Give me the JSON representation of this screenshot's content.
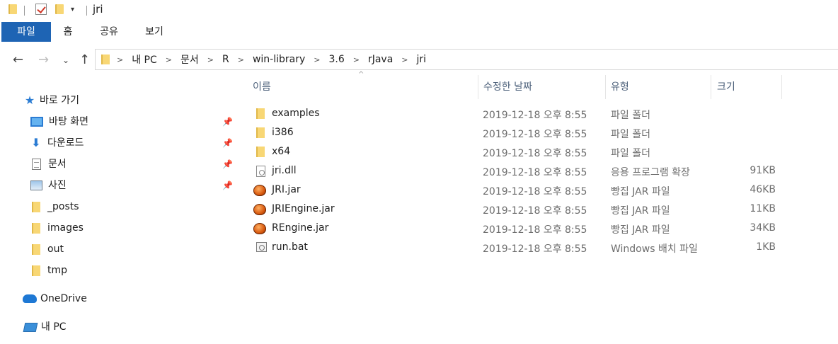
{
  "window": {
    "title": "jri"
  },
  "ribbon": {
    "tabs": [
      "파일",
      "홈",
      "공유",
      "보기"
    ]
  },
  "address": {
    "crumbs": [
      "내 PC",
      "문서",
      "R",
      "win-library",
      "3.6",
      "rJava",
      "jri"
    ]
  },
  "nav": {
    "quick_access": "바로 가기",
    "items": [
      {
        "label": "바탕 화면",
        "icon": "desktop-icon",
        "pinned": true
      },
      {
        "label": "다운로드",
        "icon": "download-icon",
        "pinned": true
      },
      {
        "label": "문서",
        "icon": "document-icon",
        "pinned": true
      },
      {
        "label": "사진",
        "icon": "pictures-icon",
        "pinned": true
      },
      {
        "label": "_posts",
        "icon": "folder-icon",
        "pinned": false
      },
      {
        "label": "images",
        "icon": "folder-icon",
        "pinned": false
      },
      {
        "label": "out",
        "icon": "folder-icon",
        "pinned": false
      },
      {
        "label": "tmp",
        "icon": "folder-icon",
        "pinned": false
      }
    ],
    "onedrive": "OneDrive",
    "this_pc": "내 PC"
  },
  "columns": {
    "name": "이름",
    "date": "수정한 날짜",
    "type": "유형",
    "size": "크기"
  },
  "files": [
    {
      "name": "examples",
      "date": "2019-12-18 오후 8:55",
      "type": "파일 폴더",
      "size": "",
      "icon": "folder-icon"
    },
    {
      "name": "i386",
      "date": "2019-12-18 오후 8:55",
      "type": "파일 폴더",
      "size": "",
      "icon": "folder-icon"
    },
    {
      "name": "x64",
      "date": "2019-12-18 오후 8:55",
      "type": "파일 폴더",
      "size": "",
      "icon": "folder-icon"
    },
    {
      "name": "jri.dll",
      "date": "2019-12-18 오후 8:55",
      "type": "응용 프로그램 확장",
      "size": "91KB",
      "icon": "dll-file-icon"
    },
    {
      "name": "JRI.jar",
      "date": "2019-12-18 오후 8:55",
      "type": "빵집 JAR 파일",
      "size": "46KB",
      "icon": "jar-file-icon"
    },
    {
      "name": "JRIEngine.jar",
      "date": "2019-12-18 오후 8:55",
      "type": "빵집 JAR 파일",
      "size": "11KB",
      "icon": "jar-file-icon"
    },
    {
      "name": "REngine.jar",
      "date": "2019-12-18 오후 8:55",
      "type": "빵집 JAR 파일",
      "size": "34KB",
      "icon": "jar-file-icon"
    },
    {
      "name": "run.bat",
      "date": "2019-12-18 오후 8:55",
      "type": "Windows 배치 파일",
      "size": "1KB",
      "icon": "batch-file-icon"
    }
  ],
  "colors": {
    "file_tab_bg": "#1e64b4",
    "accent": "#2b7cd3",
    "folder": "#f8d775"
  }
}
